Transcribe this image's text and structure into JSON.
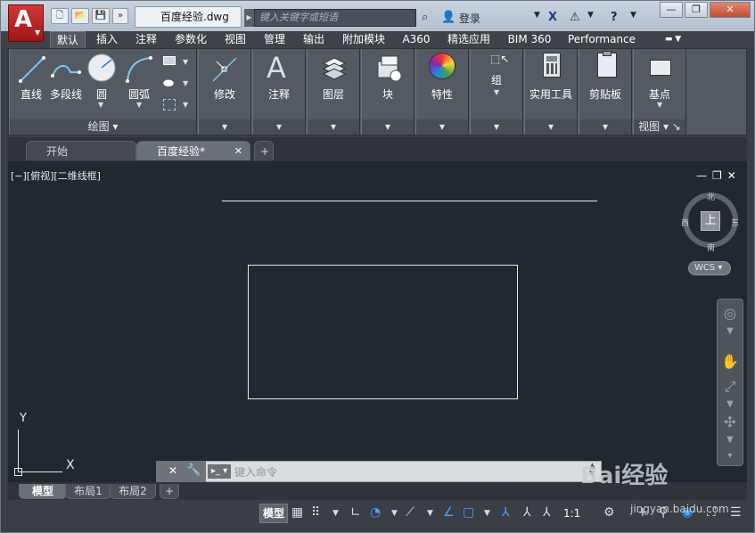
{
  "app": {
    "logo_letter": "A",
    "file_name": "百度经验.dwg",
    "search_placeholder": "键入关键字或短语",
    "login_label": "登录"
  },
  "ribbon_tabs": [
    "默认",
    "插入",
    "注释",
    "参数化",
    "视图",
    "管理",
    "输出",
    "附加模块",
    "A360",
    "精选应用",
    "BIM 360",
    "Performance"
  ],
  "draw_panel": {
    "title": "绘图",
    "buttons": [
      "直线",
      "多段线",
      "圆",
      "圆弧"
    ]
  },
  "panels": {
    "modify": "修改",
    "annotate": "注释",
    "layers": "图层",
    "block": "块",
    "properties": "特性",
    "group": "组",
    "utilities": "实用工具",
    "clipboard": "剪贴板",
    "view_button": "基点",
    "view_title": "视图"
  },
  "doc_tabs": [
    {
      "label": "开始",
      "active": false
    },
    {
      "label": "百度经验*",
      "active": true
    }
  ],
  "viewport": {
    "label": "[−][俯视][二维线框]",
    "viewcube_face": "上",
    "compass": {
      "north": "北",
      "south": "南",
      "east": "东",
      "west": "西"
    },
    "wcs": "WCS"
  },
  "ucs": {
    "x_label": "X",
    "y_label": "Y"
  },
  "command_line": {
    "placeholder": "键入命令"
  },
  "layout_tabs": [
    {
      "label": "模型",
      "active": true
    },
    {
      "label": "布局1",
      "active": false
    },
    {
      "label": "布局2",
      "active": false
    }
  ],
  "status": {
    "model_button": "模型",
    "scale": "1:1"
  },
  "watermark": {
    "main": "Bai经验",
    "sub": "jingyan.baidu.com"
  },
  "colors": {
    "accent_red": "#c42a2a",
    "canvas_bg": "#212830",
    "ribbon_bg": "#535a61",
    "accent_blue": "#2f8bd8"
  }
}
